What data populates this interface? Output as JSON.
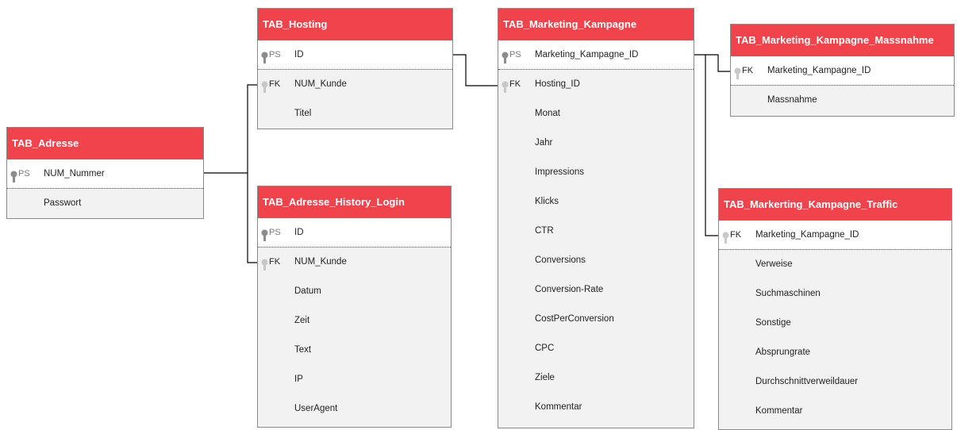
{
  "tables": {
    "adresse": {
      "title": "TAB_Adresse",
      "rows": [
        {
          "key": "PS",
          "name": "NUM_Nummer"
        },
        {
          "key": "",
          "name": "Passwort"
        }
      ]
    },
    "hosting": {
      "title": "TAB_Hosting",
      "rows": [
        {
          "key": "PS",
          "name": "ID"
        },
        {
          "key": "FK",
          "name": "NUM_Kunde"
        },
        {
          "key": "",
          "name": "Titel"
        }
      ]
    },
    "history": {
      "title": "TAB_Adresse_History_Login",
      "rows": [
        {
          "key": "PS",
          "name": "ID"
        },
        {
          "key": "FK",
          "name": "NUM_Kunde"
        },
        {
          "key": "",
          "name": "Datum"
        },
        {
          "key": "",
          "name": "Zeit"
        },
        {
          "key": "",
          "name": "Text"
        },
        {
          "key": "",
          "name": "IP"
        },
        {
          "key": "",
          "name": "UserAgent"
        }
      ]
    },
    "kampagne": {
      "title": "TAB_Marketing_Kampagne",
      "rows": [
        {
          "key": "PS",
          "name": "Marketing_Kampagne_ID"
        },
        {
          "key": "FK",
          "name": "Hosting_ID"
        },
        {
          "key": "",
          "name": "Monat"
        },
        {
          "key": "",
          "name": "Jahr"
        },
        {
          "key": "",
          "name": "Impressions"
        },
        {
          "key": "",
          "name": "Klicks"
        },
        {
          "key": "",
          "name": "CTR"
        },
        {
          "key": "",
          "name": "Conversions"
        },
        {
          "key": "",
          "name": "Conversion-Rate"
        },
        {
          "key": "",
          "name": "CostPerConversion"
        },
        {
          "key": "",
          "name": "CPC"
        },
        {
          "key": "",
          "name": "Ziele"
        },
        {
          "key": "",
          "name": "Kommentar"
        }
      ]
    },
    "massnahme": {
      "title": "TAB_Marketing_Kampagne_Massnahme",
      "rows": [
        {
          "key": "FK",
          "name": "Marketing_Kampagne_ID"
        },
        {
          "key": "",
          "name": "Massnahme"
        }
      ]
    },
    "traffic": {
      "title": "TAB_Markerting_Kampagne_Traffic",
      "rows": [
        {
          "key": "FK",
          "name": "Marketing_Kampagne_ID"
        },
        {
          "key": "",
          "name": "Verweise"
        },
        {
          "key": "",
          "name": "Suchmaschinen"
        },
        {
          "key": "",
          "name": "Sonstige"
        },
        {
          "key": "",
          "name": "Absprungrate"
        },
        {
          "key": "",
          "name": "Durchschnittverweildauer"
        },
        {
          "key": "",
          "name": "Kommentar"
        }
      ]
    }
  },
  "colors": {
    "header": "#f0434c",
    "body": "#f2f2f2",
    "pk_row": "#ffffff",
    "line": "#000000"
  }
}
